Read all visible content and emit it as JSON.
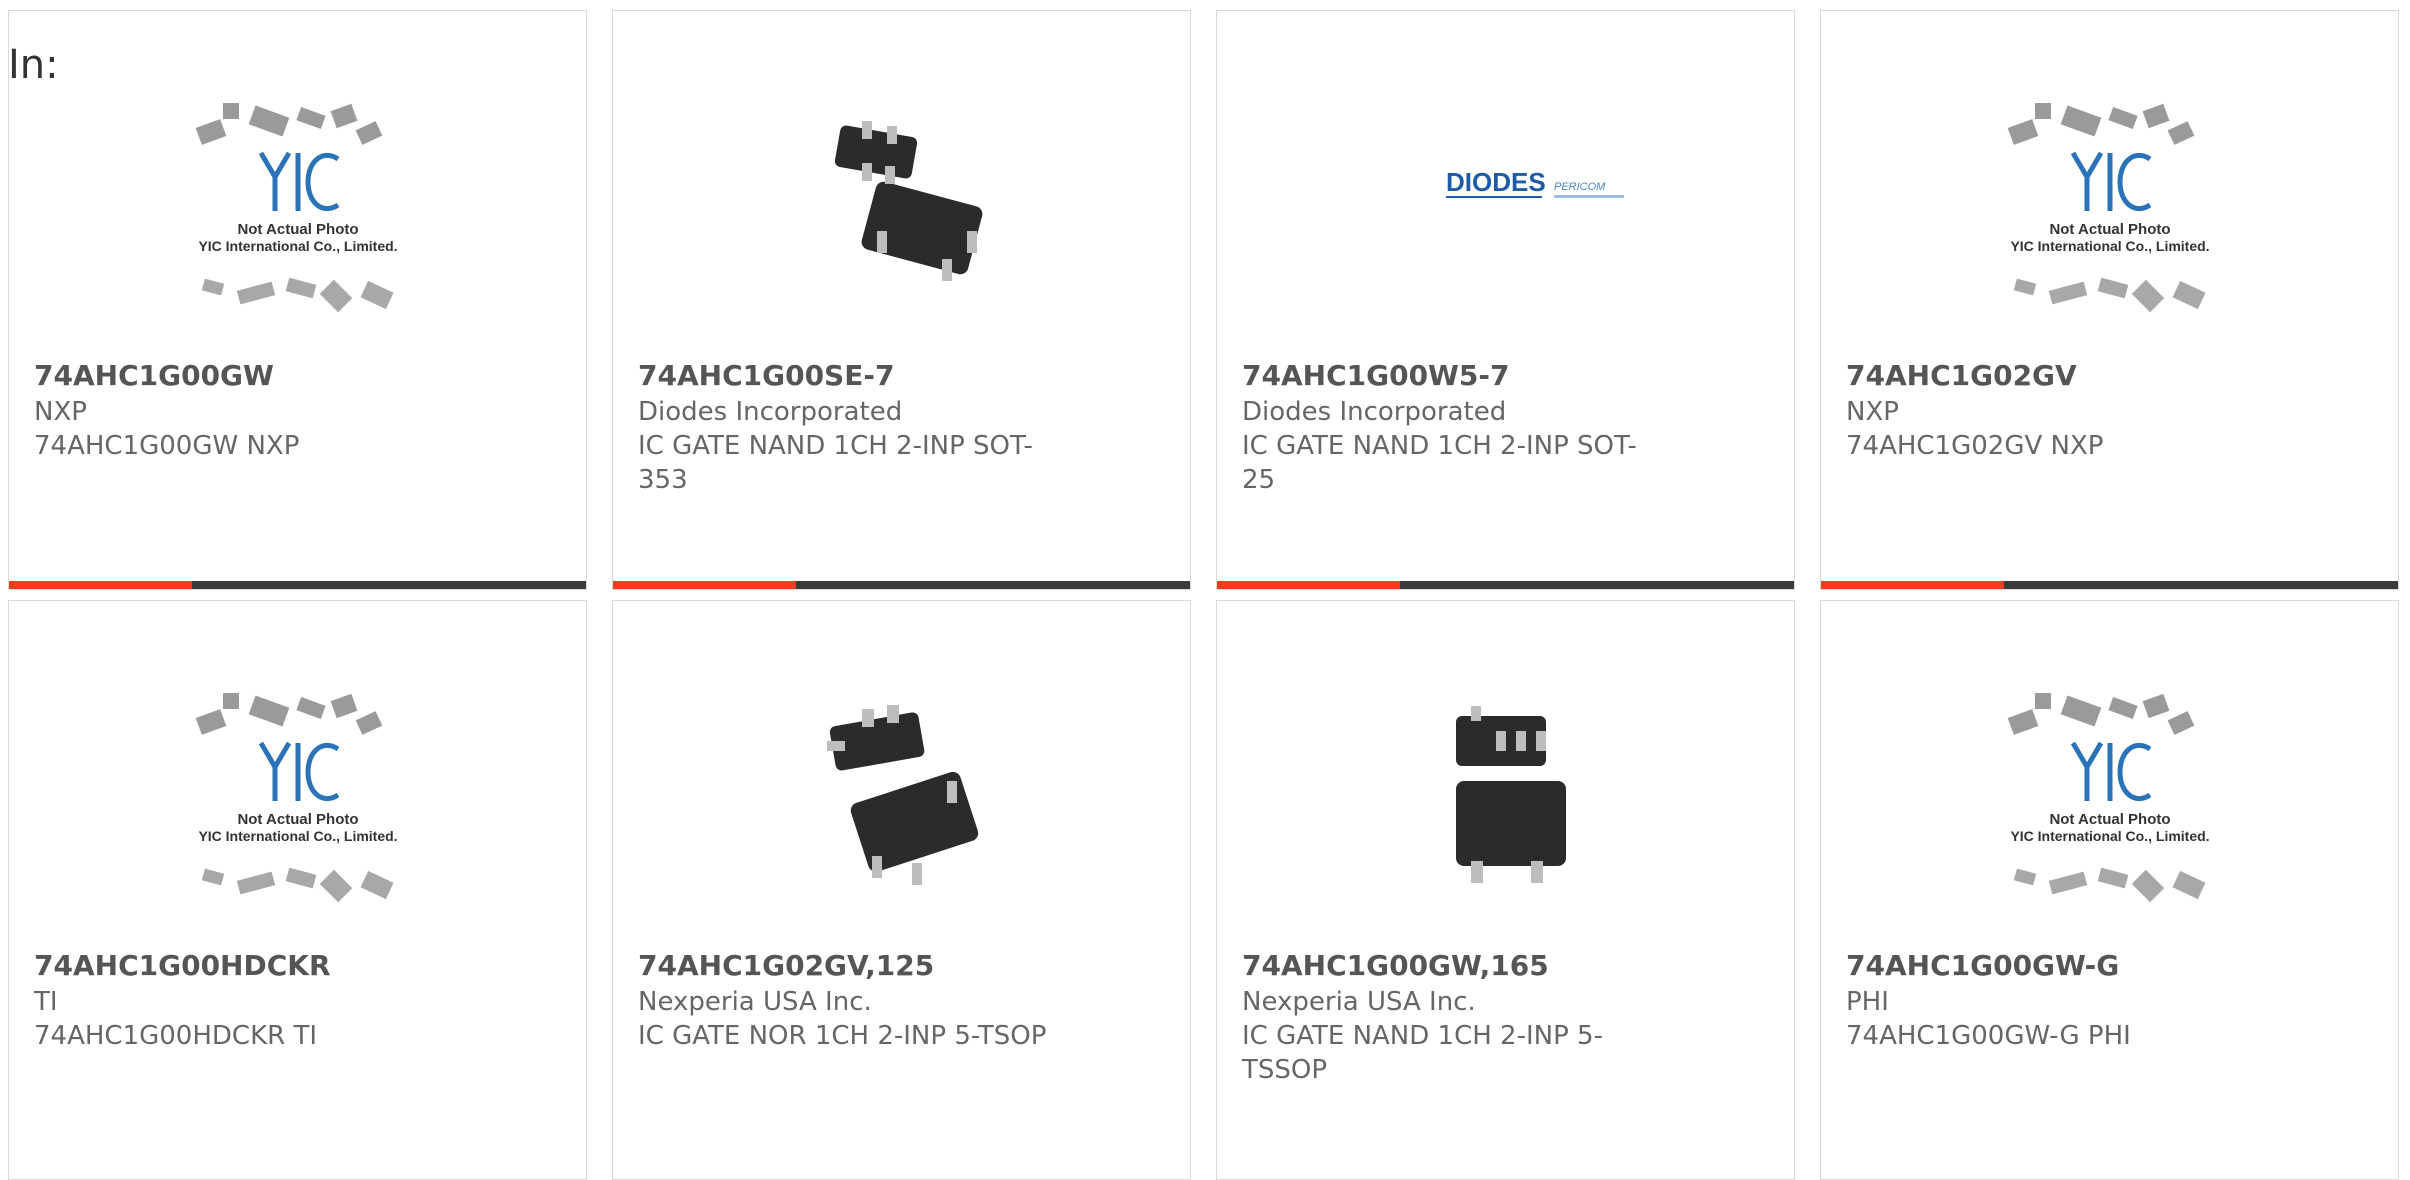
{
  "filter_label": "In:",
  "colors": {
    "accent": "#e8411b",
    "bar": "#3a3a3a",
    "border": "#d9d9d9"
  },
  "products": [
    {
      "name": "74AHC1G00GW",
      "manufacturer": "NXP",
      "description": "74AHC1G00GW NXP",
      "image": "yic-placeholder"
    },
    {
      "name": "74AHC1G00SE-7",
      "manufacturer": "Diodes Incorporated",
      "description": "IC GATE NAND 1CH 2-INP SOT-353",
      "image": "sot-package"
    },
    {
      "name": "74AHC1G00W5-7",
      "manufacturer": "Diodes Incorporated",
      "description": "IC GATE NAND 1CH 2-INP SOT-25",
      "image": "diodes-logo"
    },
    {
      "name": "74AHC1G02GV",
      "manufacturer": "NXP",
      "description": "74AHC1G02GV NXP",
      "image": "yic-placeholder"
    },
    {
      "name": "74AHC1G00HDCKR",
      "manufacturer": "TI",
      "description": "74AHC1G00HDCKR TI",
      "image": "yic-placeholder"
    },
    {
      "name": "74AHC1G02GV,125",
      "manufacturer": "Nexperia USA Inc.",
      "description": "IC GATE NOR 1CH 2-INP 5-TSOP",
      "image": "sot-package"
    },
    {
      "name": "74AHC1G00GW,165",
      "manufacturer": "Nexperia USA Inc.",
      "description": "IC GATE NAND 1CH 2-INP 5-TSSOP",
      "image": "sot-package"
    },
    {
      "name": "74AHC1G00GW-G",
      "manufacturer": "PHI",
      "description": "74AHC1G00GW-G PHI",
      "image": "yic-placeholder"
    }
  ],
  "placeholder": {
    "logo_text": "YIC",
    "caption_line1": "Not Actual Photo",
    "caption_line2": "YIC International Co., Limited."
  },
  "diodes_logo": {
    "brand": "DIODES",
    "secondary": "PERICOM"
  }
}
